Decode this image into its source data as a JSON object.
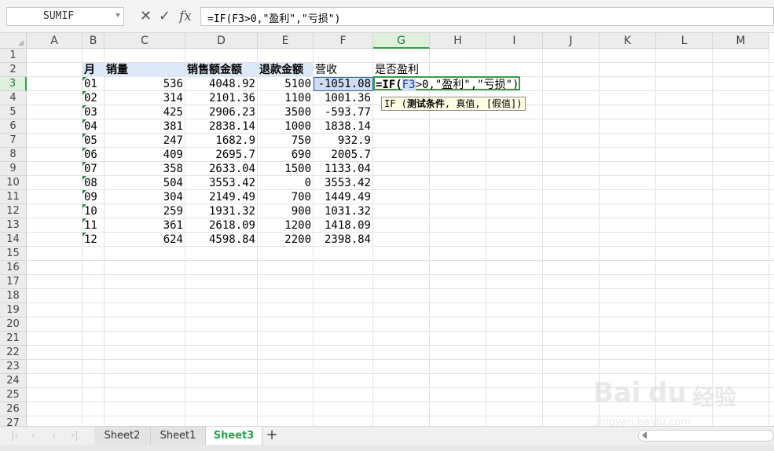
{
  "formula_bar": {
    "name_box": "SUMIF",
    "cancel_glyph": "✕",
    "enter_glyph": "✓",
    "fx_label": "fx",
    "formula": "=IF(F3>0,\"盈利\",\"亏损\")"
  },
  "columns": [
    "A",
    "B",
    "C",
    "D",
    "E",
    "F",
    "G",
    "H",
    "I",
    "J",
    "K",
    "L",
    "M"
  ],
  "rows": [
    "1",
    "2",
    "3",
    "4",
    "5",
    "6",
    "7",
    "8",
    "9",
    "10",
    "11",
    "12",
    "13",
    "14",
    "15",
    "16",
    "17",
    "18",
    "19",
    "20",
    "21",
    "22",
    "23",
    "24",
    "25",
    "26",
    "27"
  ],
  "selected_column": "G",
  "selected_row": "3",
  "table": {
    "headers": {
      "B": "月",
      "C": "销量",
      "D": "销售额金额",
      "E": "退款金额",
      "F": "营收",
      "G": "是否盈利"
    },
    "rows": [
      {
        "month": "01",
        "qty": "536",
        "sales": "4048.92",
        "refund": "5100",
        "revenue": "-1051.08"
      },
      {
        "month": "02",
        "qty": "314",
        "sales": "2101.36",
        "refund": "1100",
        "revenue": "1001.36"
      },
      {
        "month": "03",
        "qty": "425",
        "sales": "2906.23",
        "refund": "3500",
        "revenue": "-593.77"
      },
      {
        "month": "04",
        "qty": "381",
        "sales": "2838.14",
        "refund": "1000",
        "revenue": "1838.14"
      },
      {
        "month": "05",
        "qty": "247",
        "sales": "1682.9",
        "refund": "750",
        "revenue": "932.9"
      },
      {
        "month": "06",
        "qty": "409",
        "sales": "2695.7",
        "refund": "690",
        "revenue": "2005.7"
      },
      {
        "month": "07",
        "qty": "358",
        "sales": "2633.04",
        "refund": "1500",
        "revenue": "1133.04"
      },
      {
        "month": "08",
        "qty": "504",
        "sales": "3553.42",
        "refund": "0",
        "revenue": "3553.42"
      },
      {
        "month": "09",
        "qty": "304",
        "sales": "2149.49",
        "refund": "700",
        "revenue": "1449.49"
      },
      {
        "month": "10",
        "qty": "259",
        "sales": "1931.32",
        "refund": "900",
        "revenue": "1031.32"
      },
      {
        "month": "11",
        "qty": "361",
        "sales": "2618.09",
        "refund": "1200",
        "revenue": "1418.09"
      },
      {
        "month": "12",
        "qty": "624",
        "sales": "4598.84",
        "refund": "2200",
        "revenue": "2398.84"
      }
    ]
  },
  "edit_cell": {
    "prefix": "=IF(",
    "ref": "F3",
    "suffix": ">0,\"盈利\",\"亏损\")"
  },
  "tooltip": {
    "fn": "IF (",
    "arg1": "测试条件",
    "rest": ", 真值, [假值])"
  },
  "sheet_tabs": [
    "Sheet2",
    "Sheet1",
    "Sheet3"
  ],
  "active_tab": "Sheet3",
  "add_tab_glyph": "+",
  "watermark": {
    "brand": "Bai",
    "brand2": "du",
    "cn": "经验",
    "url": "jingyan.baidu.com"
  }
}
